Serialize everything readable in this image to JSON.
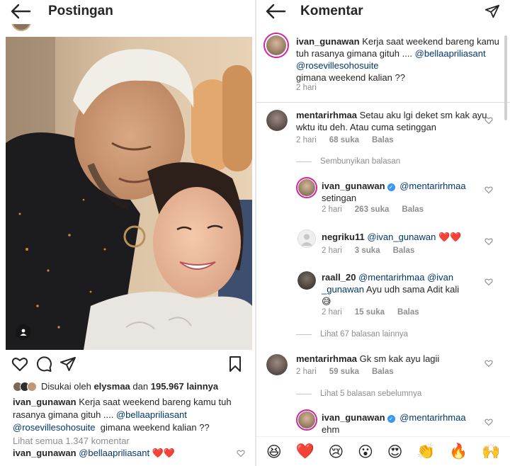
{
  "left": {
    "title": "Postingan",
    "likes": {
      "prefix": "Disukai oleh",
      "user": "elysmaa",
      "connector": "dan",
      "count": "195.967 lainnya"
    },
    "caption": {
      "user": "ivan_gunawan",
      "text": "Kerja  saat weekend bareng kamu tuh rasanya  gimana gituh ....",
      "mention1": "@bellaapriliasant",
      "mention2": "@rosevillesohosuite",
      "tail": "gimana weekend kalian ??"
    },
    "view_all": "Lihat semua 1.347 komentar",
    "last_comment": {
      "user": "ivan_gunawan",
      "mention": "@bellaapriliasant",
      "emoji": "❤️❤️"
    }
  },
  "right": {
    "title": "Komentar",
    "caption": {
      "user": "ivan_gunawan",
      "text": "Kerja  saat weekend bareng kamu tuh  rasanya  gimana gituh ....",
      "mention1": "@bellaapriliasant",
      "mention2": "@rosevillesohosuite",
      "tail": "gimana weekend kalian ??",
      "time": "2 hari"
    },
    "comments": [
      {
        "user": "mentarirhmaa",
        "text": "Setau aku lgi deket sm kak ayu wktu itu deh. Atau cuma setinggan",
        "time": "2 hari",
        "likes": "68 suka",
        "reply": "Balas"
      },
      {
        "user": "ivan_gunawan",
        "mention": "@mentarirhmaa",
        "text": "setingan",
        "time": "2 hari",
        "likes": "263 suka",
        "reply": "Balas"
      },
      {
        "user": "negriku11",
        "mention": "@ivan_gunawan",
        "emoji": "❤️❤️",
        "time": "2 hari",
        "likes": "3 suka",
        "reply": "Balas"
      },
      {
        "user": "raall_20",
        "mention": "@mentarirhmaa",
        "mention2a": "@ivan",
        "mention2b": "_gunawan",
        "text": "Ayu udh sama Adit kali",
        "emoji": "😅",
        "time": "2 hari",
        "likes": "15 suka",
        "reply": "Balas"
      },
      {
        "user": "mentarirhmaa",
        "text": "Gk sm kak ayu lagii",
        "time": "2 hari",
        "likes": "59 suka",
        "reply": "Balas"
      },
      {
        "user": "ivan_gunawan",
        "mention": "@mentarirhmaa",
        "text": "ehm"
      }
    ],
    "hide_replies": "Sembunyikan balasan",
    "more_replies": "Lihat 67 balasan lainnya",
    "prev_replies": "Lihat 5 balasan sebelumnya",
    "emoji_bar": [
      "😆",
      "❤️",
      "😢",
      "😮",
      "😍",
      "👏",
      "🔥",
      "🙌"
    ]
  },
  "colors": {
    "link": "#00376b",
    "meta": "#8e8e8e",
    "verified": "#3897f0",
    "heart": "#ed4956"
  }
}
